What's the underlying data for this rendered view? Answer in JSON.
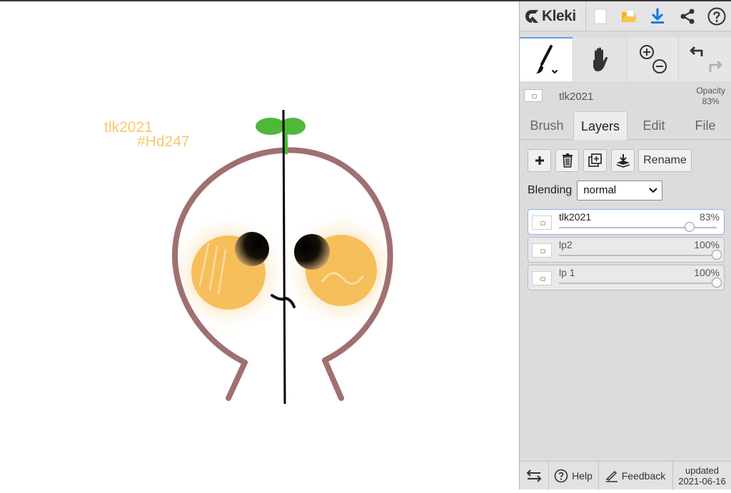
{
  "app": {
    "name": "Kleki"
  },
  "canvas": {
    "text_line1": "tlk2021",
    "text_line2": "#Hd247",
    "text_color": "#f5c96a"
  },
  "header": {
    "icons": [
      "new-image-icon",
      "open-folder-icon",
      "download-icon",
      "share-icon",
      "help-icon"
    ]
  },
  "tools": {
    "items": [
      {
        "name": "brush-tool",
        "active": true
      },
      {
        "name": "hand-tool",
        "active": false
      },
      {
        "name": "zoom-tool",
        "active": false
      },
      {
        "name": "undo-redo",
        "active": false
      }
    ]
  },
  "current_layer": {
    "name": "tlk2021",
    "opacity_label": "Opacity",
    "opacity_value": "83%"
  },
  "tabs": [
    {
      "label": "Brush",
      "active": false
    },
    {
      "label": "Layers",
      "active": true
    },
    {
      "label": "Edit",
      "active": false
    },
    {
      "label": "File",
      "active": false
    }
  ],
  "layer_actions": {
    "add_icon": "plus-icon",
    "delete_icon": "trash-icon",
    "duplicate_icon": "duplicate-icon",
    "merge_icon": "merge-down-icon",
    "rename_label": "Rename"
  },
  "blending": {
    "label": "Blending",
    "value": "normal"
  },
  "layers": [
    {
      "name": "tlk2021",
      "opacity_label": "83%",
      "opacity": 0.83,
      "selected": true
    },
    {
      "name": "lp2",
      "opacity_label": "100%",
      "opacity": 1.0,
      "selected": false
    },
    {
      "name": "lp 1",
      "opacity_label": "100%",
      "opacity": 1.0,
      "selected": false
    }
  ],
  "footer": {
    "help_label": "Help",
    "feedback_label": "Feedback",
    "updated_line1": "updated",
    "updated_line2": "2021-06-16"
  },
  "colors": {
    "accent": "#6aa0e0",
    "outline": "#a07070",
    "sprout": "#4fb83a",
    "cheek": "#f5b94e",
    "download_blue": "#1a7de0",
    "folder_yellow": "#f2b21c"
  }
}
